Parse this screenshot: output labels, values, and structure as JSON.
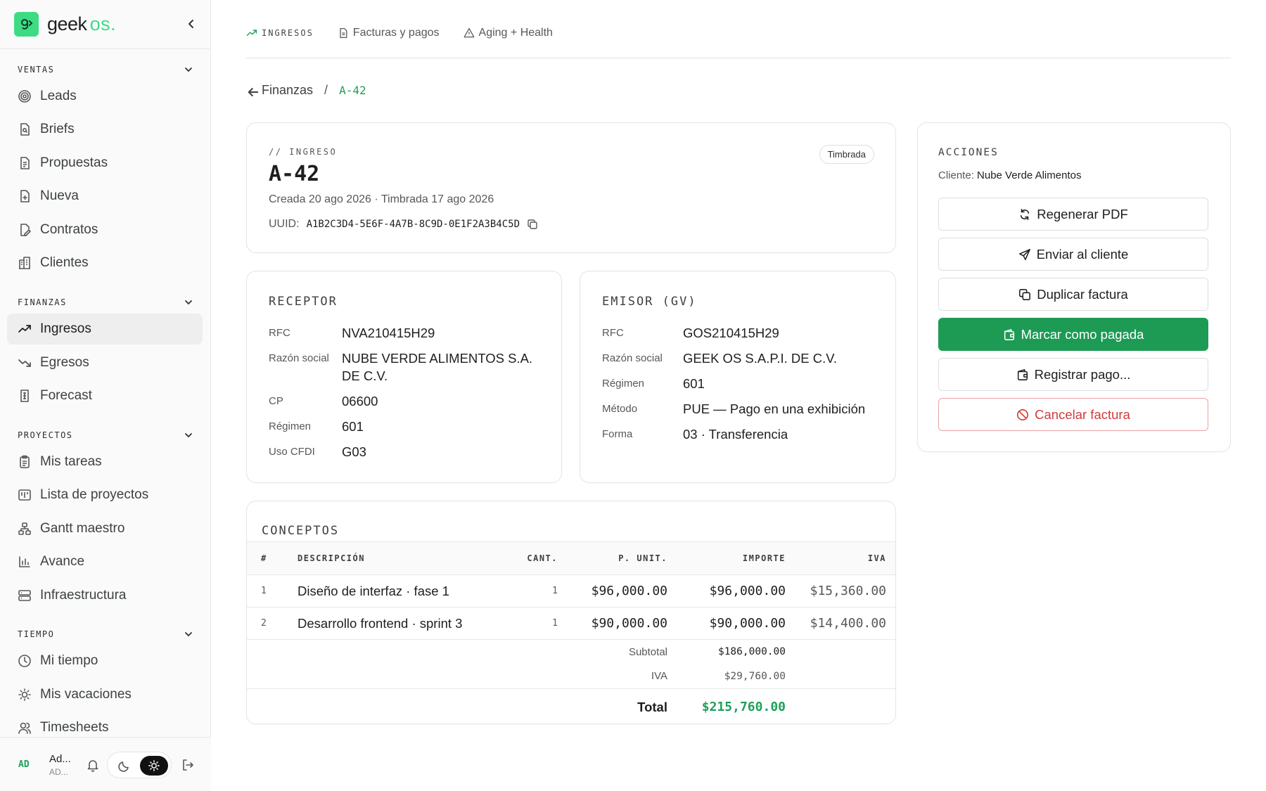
{
  "brand": {
    "name": "geek",
    "suffix": "os."
  },
  "sidebar": {
    "sections": [
      {
        "title": "VENTAS",
        "items": [
          {
            "label": "Leads",
            "icon": "target-icon"
          },
          {
            "label": "Briefs",
            "icon": "brief-icon"
          },
          {
            "label": "Propuestas",
            "icon": "document-icon"
          },
          {
            "label": "Nueva",
            "icon": "file-plus-icon"
          },
          {
            "label": "Contratos",
            "icon": "file-pen-icon"
          },
          {
            "label": "Clientes",
            "icon": "building-icon"
          }
        ]
      },
      {
        "title": "FINANZAS",
        "items": [
          {
            "label": "Ingresos",
            "icon": "trend-up-icon",
            "active": true
          },
          {
            "label": "Egresos",
            "icon": "trend-down-icon"
          },
          {
            "label": "Forecast",
            "icon": "forecast-icon"
          }
        ]
      },
      {
        "title": "PROYECTOS",
        "items": [
          {
            "label": "Mis tareas",
            "icon": "clipboard-icon"
          },
          {
            "label": "Lista de proyectos",
            "icon": "kanban-icon"
          },
          {
            "label": "Gantt maestro",
            "icon": "network-icon"
          },
          {
            "label": "Avance",
            "icon": "bar-chart-icon"
          },
          {
            "label": "Infraestructura",
            "icon": "server-icon"
          }
        ]
      },
      {
        "title": "TIEMPO",
        "items": [
          {
            "label": "Mi tiempo",
            "icon": "clock-icon"
          },
          {
            "label": "Mis vacaciones",
            "icon": "sun-icon"
          },
          {
            "label": "Timesheets",
            "icon": "users-icon"
          }
        ]
      }
    ],
    "footer": {
      "avatar": "AD",
      "name": "Ad...",
      "role": "AD..."
    }
  },
  "tabs": [
    {
      "label": "INGRESOS",
      "icon": "trend-up-icon",
      "active": true
    },
    {
      "label": "Facturas y pagos",
      "icon": "file-icon"
    },
    {
      "label": "Aging + Health",
      "icon": "alert-icon"
    }
  ],
  "breadcrumb": {
    "parent": "Finanzas",
    "separator": "/",
    "current": "A-42"
  },
  "invoice": {
    "eyebrow": "// INGRESO",
    "number": "A-42",
    "dates": "Creada 20 ago 2026 · Timbrada 17 ago 2026",
    "uuid_label": "UUID:",
    "uuid": "A1B2C3D4-5E6F-4A7B-8C9D-0E1F2A3B4C5D",
    "status": "Timbrada"
  },
  "receptor": {
    "title": "RECEPTOR",
    "rows": [
      {
        "k": "RFC",
        "v": "NVA210415H29"
      },
      {
        "k": "Razón social",
        "v": "NUBE VERDE ALIMENTOS S.A. DE C.V."
      },
      {
        "k": "CP",
        "v": "06600"
      },
      {
        "k": "Régimen",
        "v": "601"
      },
      {
        "k": "Uso CFDI",
        "v": "G03"
      }
    ]
  },
  "emisor": {
    "title": "EMISOR (GV)",
    "rows": [
      {
        "k": "RFC",
        "v": "GOS210415H29"
      },
      {
        "k": "Razón social",
        "v": "GEEK OS S.A.P.I. DE C.V."
      },
      {
        "k": "Régimen",
        "v": "601"
      },
      {
        "k": "Método",
        "v": "PUE — Pago en una exhibición"
      },
      {
        "k": "Forma",
        "v": "03 · Transferencia"
      }
    ]
  },
  "conceptos": {
    "title": "CONCEPTOS",
    "headers": {
      "num": "#",
      "desc": "DESCRIPCIÓN",
      "qty": "CANT.",
      "unit": "P. UNIT.",
      "amount": "IMPORTE",
      "iva": "IVA"
    },
    "rows": [
      {
        "num": "1",
        "desc": "Diseño de interfaz · fase 1",
        "qty": "1",
        "unit": "$96,000.00",
        "amount": "$96,000.00",
        "iva": "$15,360.00"
      },
      {
        "num": "2",
        "desc": "Desarrollo frontend · sprint 3",
        "qty": "1",
        "unit": "$90,000.00",
        "amount": "$90,000.00",
        "iva": "$14,400.00"
      }
    ],
    "subtotal_label": "Subtotal",
    "subtotal": "$186,000.00",
    "iva_label": "IVA",
    "iva_total": "$29,760.00",
    "total_label": "Total",
    "total": "$215,760.00"
  },
  "actions": {
    "title": "ACCIONES",
    "client_label": "Cliente:",
    "client_name": "Nube Verde Alimentos",
    "buttons": [
      {
        "label": "Regenerar PDF",
        "icon": "refresh-icon"
      },
      {
        "label": "Enviar al cliente",
        "icon": "send-icon"
      },
      {
        "label": "Duplicar factura",
        "icon": "copy-icon"
      },
      {
        "label": "Marcar como pagada",
        "icon": "wallet-icon",
        "variant": "primary"
      },
      {
        "label": "Registrar pago...",
        "icon": "wallet-icon"
      },
      {
        "label": "Cancelar factura",
        "icon": "ban-icon",
        "variant": "danger"
      }
    ]
  },
  "colors": {
    "accent": "#1d9a54",
    "brand": "#3ddc84",
    "danger": "#d33a3a"
  }
}
